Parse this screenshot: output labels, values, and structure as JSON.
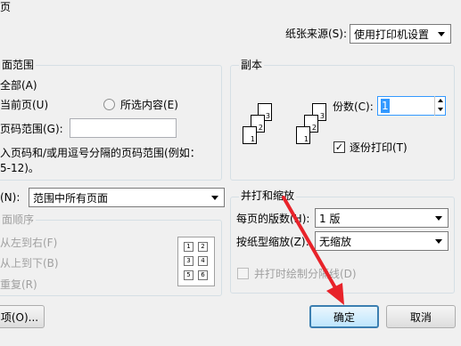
{
  "top": {
    "left_fragment": "页",
    "paper_source_label": "纸张来源(S):",
    "paper_source_value": "使用打印机设置"
  },
  "page_range": {
    "title": "面范围",
    "all": "全部(A)",
    "current": "当前页(U)",
    "selection": "所选内容(E)",
    "pages": "页码范围(G):",
    "pages_value": "",
    "hint_line1": "入页码和/或用逗号分隔的页码范围(例如：",
    "hint_line2": "5-12)。"
  },
  "copies": {
    "title": "副本",
    "count_label": "份数(C):",
    "count_value": "1",
    "collate_label": "逐份打印(T)",
    "collate_checked": true,
    "page_numbers": [
      "3",
      "2",
      "1",
      "3",
      "2",
      "1"
    ]
  },
  "print_what": {
    "label": "(N):",
    "value": "范围中所有页面"
  },
  "order": {
    "title": "面顺序",
    "ltr": "从左到右(F)",
    "ttb": "从上到下(B)",
    "repeat": "重复(R)",
    "preview_numbers": [
      "1",
      "2",
      "3",
      "4",
      "5",
      "6"
    ]
  },
  "zoom": {
    "title": "并打和缩放",
    "pages_per_sheet_label": "每页的版数(H):",
    "pages_per_sheet_value": "1 版",
    "scale_label": "按纸型缩放(Z):",
    "scale_value": "无缩放",
    "draw_borders_label": "并打时绘制分隔线(D)"
  },
  "buttons": {
    "options": "项(O)...",
    "ok": "确定",
    "cancel": "取消"
  },
  "colors": {
    "annotation_arrow": "#e8232a",
    "focus_blue": "#3399ff"
  }
}
